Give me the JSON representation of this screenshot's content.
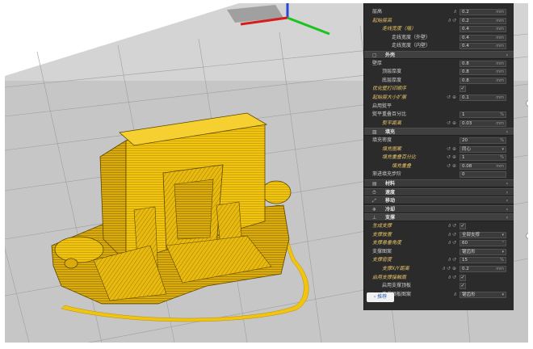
{
  "settings": {
    "rows": [
      {
        "type": "row",
        "label": "层高",
        "indent": 0,
        "value": "0.2",
        "unit": "mm",
        "icon": "∂"
      },
      {
        "type": "row",
        "label": "起始层高",
        "indent": 0,
        "value": "0.2",
        "unit": "mm",
        "icon": "∂ ↺",
        "mod": true
      },
      {
        "type": "row",
        "label": "走线宽度（墙）",
        "indent": 1,
        "value": "0.4",
        "unit": "mm",
        "mod": true
      },
      {
        "type": "row",
        "label": "走线宽度（外壁）",
        "indent": 2,
        "value": "0.4",
        "unit": "mm"
      },
      {
        "type": "row",
        "label": "走线宽度（内壁）",
        "indent": 2,
        "value": "0.4",
        "unit": "mm"
      },
      {
        "type": "section",
        "label": "外壳",
        "icon": "▢"
      },
      {
        "type": "row",
        "label": "壁厚",
        "indent": 0,
        "value": "0.8",
        "unit": "mm"
      },
      {
        "type": "row",
        "label": "顶层厚度",
        "indent": 1,
        "value": "0.8",
        "unit": "mm"
      },
      {
        "type": "row",
        "label": "底层厚度",
        "indent": 1,
        "value": "0.8",
        "unit": "mm"
      },
      {
        "type": "row",
        "label": "优化壁打印顺序",
        "indent": 0,
        "check": "✓",
        "mod": true
      },
      {
        "type": "row",
        "label": "起始层大小扩展",
        "indent": 0,
        "value": "0.1",
        "unit": "mm",
        "icon": "↺ ⊕",
        "mod": true
      },
      {
        "type": "row",
        "label": "启用熨平",
        "indent": 0
      },
      {
        "type": "row",
        "label": "熨平重叠百分比",
        "indent": 0,
        "value": "1",
        "unit": "%"
      },
      {
        "type": "row",
        "label": "熨平距离",
        "indent": 1,
        "value": "0.03",
        "unit": "mm",
        "icon": "↺ ⊕",
        "mod": true
      },
      {
        "type": "section",
        "label": "填充",
        "icon": "▨"
      },
      {
        "type": "row",
        "label": "填充密度",
        "indent": 0,
        "value": "20",
        "unit": "%"
      },
      {
        "type": "row",
        "label": "填充图案",
        "indent": 1,
        "select": "同心",
        "icon": "↺ ⊕",
        "mod": true
      },
      {
        "type": "row",
        "label": "填充重叠百分比",
        "indent": 1,
        "value": "1",
        "unit": "%",
        "icon": "↺ ⊕",
        "mod": true
      },
      {
        "type": "row",
        "label": "填充重叠",
        "indent": 2,
        "value": "0.08",
        "unit": "mm",
        "icon": "↺ ⊕",
        "mod": true
      },
      {
        "type": "row",
        "label": "渐进填充步阶",
        "indent": 0,
        "value": "0"
      },
      {
        "type": "section",
        "label": "材料",
        "icon": "▤",
        "alt": true
      },
      {
        "type": "section",
        "label": "速度",
        "icon": "⏱",
        "alt": true
      },
      {
        "type": "section",
        "label": "移动",
        "icon": "⤢",
        "alt": true
      },
      {
        "type": "section",
        "label": "冷却",
        "icon": "❄",
        "alt": true
      },
      {
        "type": "section",
        "label": "支撑",
        "icon": "⊥"
      },
      {
        "type": "row",
        "label": "生成支撑",
        "indent": 0,
        "check": "✓",
        "icon": "∂ ↺",
        "mod": true
      },
      {
        "type": "row",
        "label": "支撑放置",
        "indent": 0,
        "select": "全部支撑",
        "icon": "∂ ↺",
        "mod": true
      },
      {
        "type": "row",
        "label": "支撑悬垂角度",
        "indent": 0,
        "value": "60",
        "unit": "°",
        "icon": "∂ ↺",
        "mod": true
      },
      {
        "type": "row",
        "label": "支撑图案",
        "indent": 0,
        "select": "锯齿形"
      },
      {
        "type": "row",
        "label": "支撑密度",
        "indent": 0,
        "value": "15",
        "unit": "%",
        "icon": "∂ ↺",
        "mod": true
      },
      {
        "type": "row",
        "label": "支撑X/Y距离",
        "indent": 1,
        "value": "0.2",
        "unit": "mm",
        "icon": "∂ ↺ ⊕",
        "mod": true
      },
      {
        "type": "row",
        "label": "启用支撑接触面",
        "indent": 0,
        "check": "✓",
        "icon": "∂ ↺",
        "mod": true
      },
      {
        "type": "row",
        "label": "启用支撑顶板",
        "indent": 1,
        "check": "✓"
      },
      {
        "type": "row",
        "label": "支撑顶板图案",
        "indent": 1,
        "select": "锯齿形",
        "icon": "∂"
      }
    ],
    "recommend_label": "‹ 推荐"
  },
  "layer_slider": {
    "min_level": 0.0,
    "max_level": 1.0
  }
}
